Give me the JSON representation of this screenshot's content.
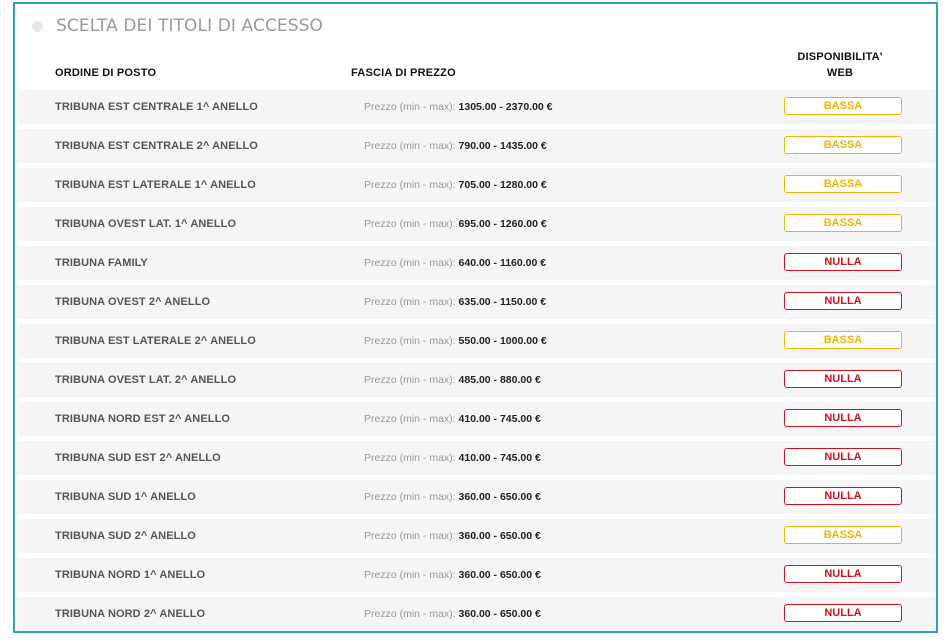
{
  "section": {
    "title": "SCELTA DEI TITOLI DI ACCESSO"
  },
  "headers": {
    "seat": "ORDINE DI POSTO",
    "price": "FASCIA DI PREZZO",
    "availability_line1": "DISPONIBILITA'",
    "availability_line2": "WEB"
  },
  "price_prefix": "Prezzo (min - max): ",
  "colors": {
    "frame": "#2ba3b5",
    "low": "#f0b400",
    "none": "#d0101a"
  },
  "rows": [
    {
      "seat": "TRIBUNA EST CENTRALE 1^ ANELLO",
      "price": "1305.00 - 2370.00 €",
      "availability": "BASSA",
      "status": "low"
    },
    {
      "seat": "TRIBUNA EST CENTRALE 2^ ANELLO",
      "price": "790.00 - 1435.00 €",
      "availability": "BASSA",
      "status": "low"
    },
    {
      "seat": "TRIBUNA EST LATERALE 1^ ANELLO",
      "price": "705.00 - 1280.00 €",
      "availability": "BASSA",
      "status": "low"
    },
    {
      "seat": "TRIBUNA OVEST LAT. 1^ ANELLO",
      "price": "695.00 - 1260.00 €",
      "availability": "BASSA",
      "status": "low"
    },
    {
      "seat": "TRIBUNA FAMILY",
      "price": "640.00 - 1160.00 €",
      "availability": "NULLA",
      "status": "none"
    },
    {
      "seat": "TRIBUNA OVEST 2^ ANELLO",
      "price": "635.00 - 1150.00 €",
      "availability": "NULLA",
      "status": "none"
    },
    {
      "seat": "TRIBUNA EST LATERALE 2^ ANELLO",
      "price": "550.00 - 1000.00 €",
      "availability": "BASSA",
      "status": "low"
    },
    {
      "seat": "TRIBUNA OVEST LAT. 2^ ANELLO",
      "price": "485.00 - 880.00 €",
      "availability": "NULLA",
      "status": "none"
    },
    {
      "seat": "TRIBUNA NORD EST 2^ ANELLO",
      "price": "410.00 - 745.00 €",
      "availability": "NULLA",
      "status": "none"
    },
    {
      "seat": "TRIBUNA SUD EST 2^ ANELLO",
      "price": "410.00 - 745.00 €",
      "availability": "NULLA",
      "status": "none"
    },
    {
      "seat": "TRIBUNA SUD 1^ ANELLO",
      "price": "360.00 - 650.00 €",
      "availability": "NULLA",
      "status": "none"
    },
    {
      "seat": "TRIBUNA SUD 2^ ANELLO",
      "price": "360.00 - 650.00 €",
      "availability": "BASSA",
      "status": "low"
    },
    {
      "seat": "TRIBUNA NORD 1^ ANELLO",
      "price": "360.00 - 650.00 €",
      "availability": "NULLA",
      "status": "none"
    },
    {
      "seat": "TRIBUNA NORD 2^ ANELLO",
      "price": "360.00 - 650.00 €",
      "availability": "NULLA",
      "status": "none"
    }
  ]
}
